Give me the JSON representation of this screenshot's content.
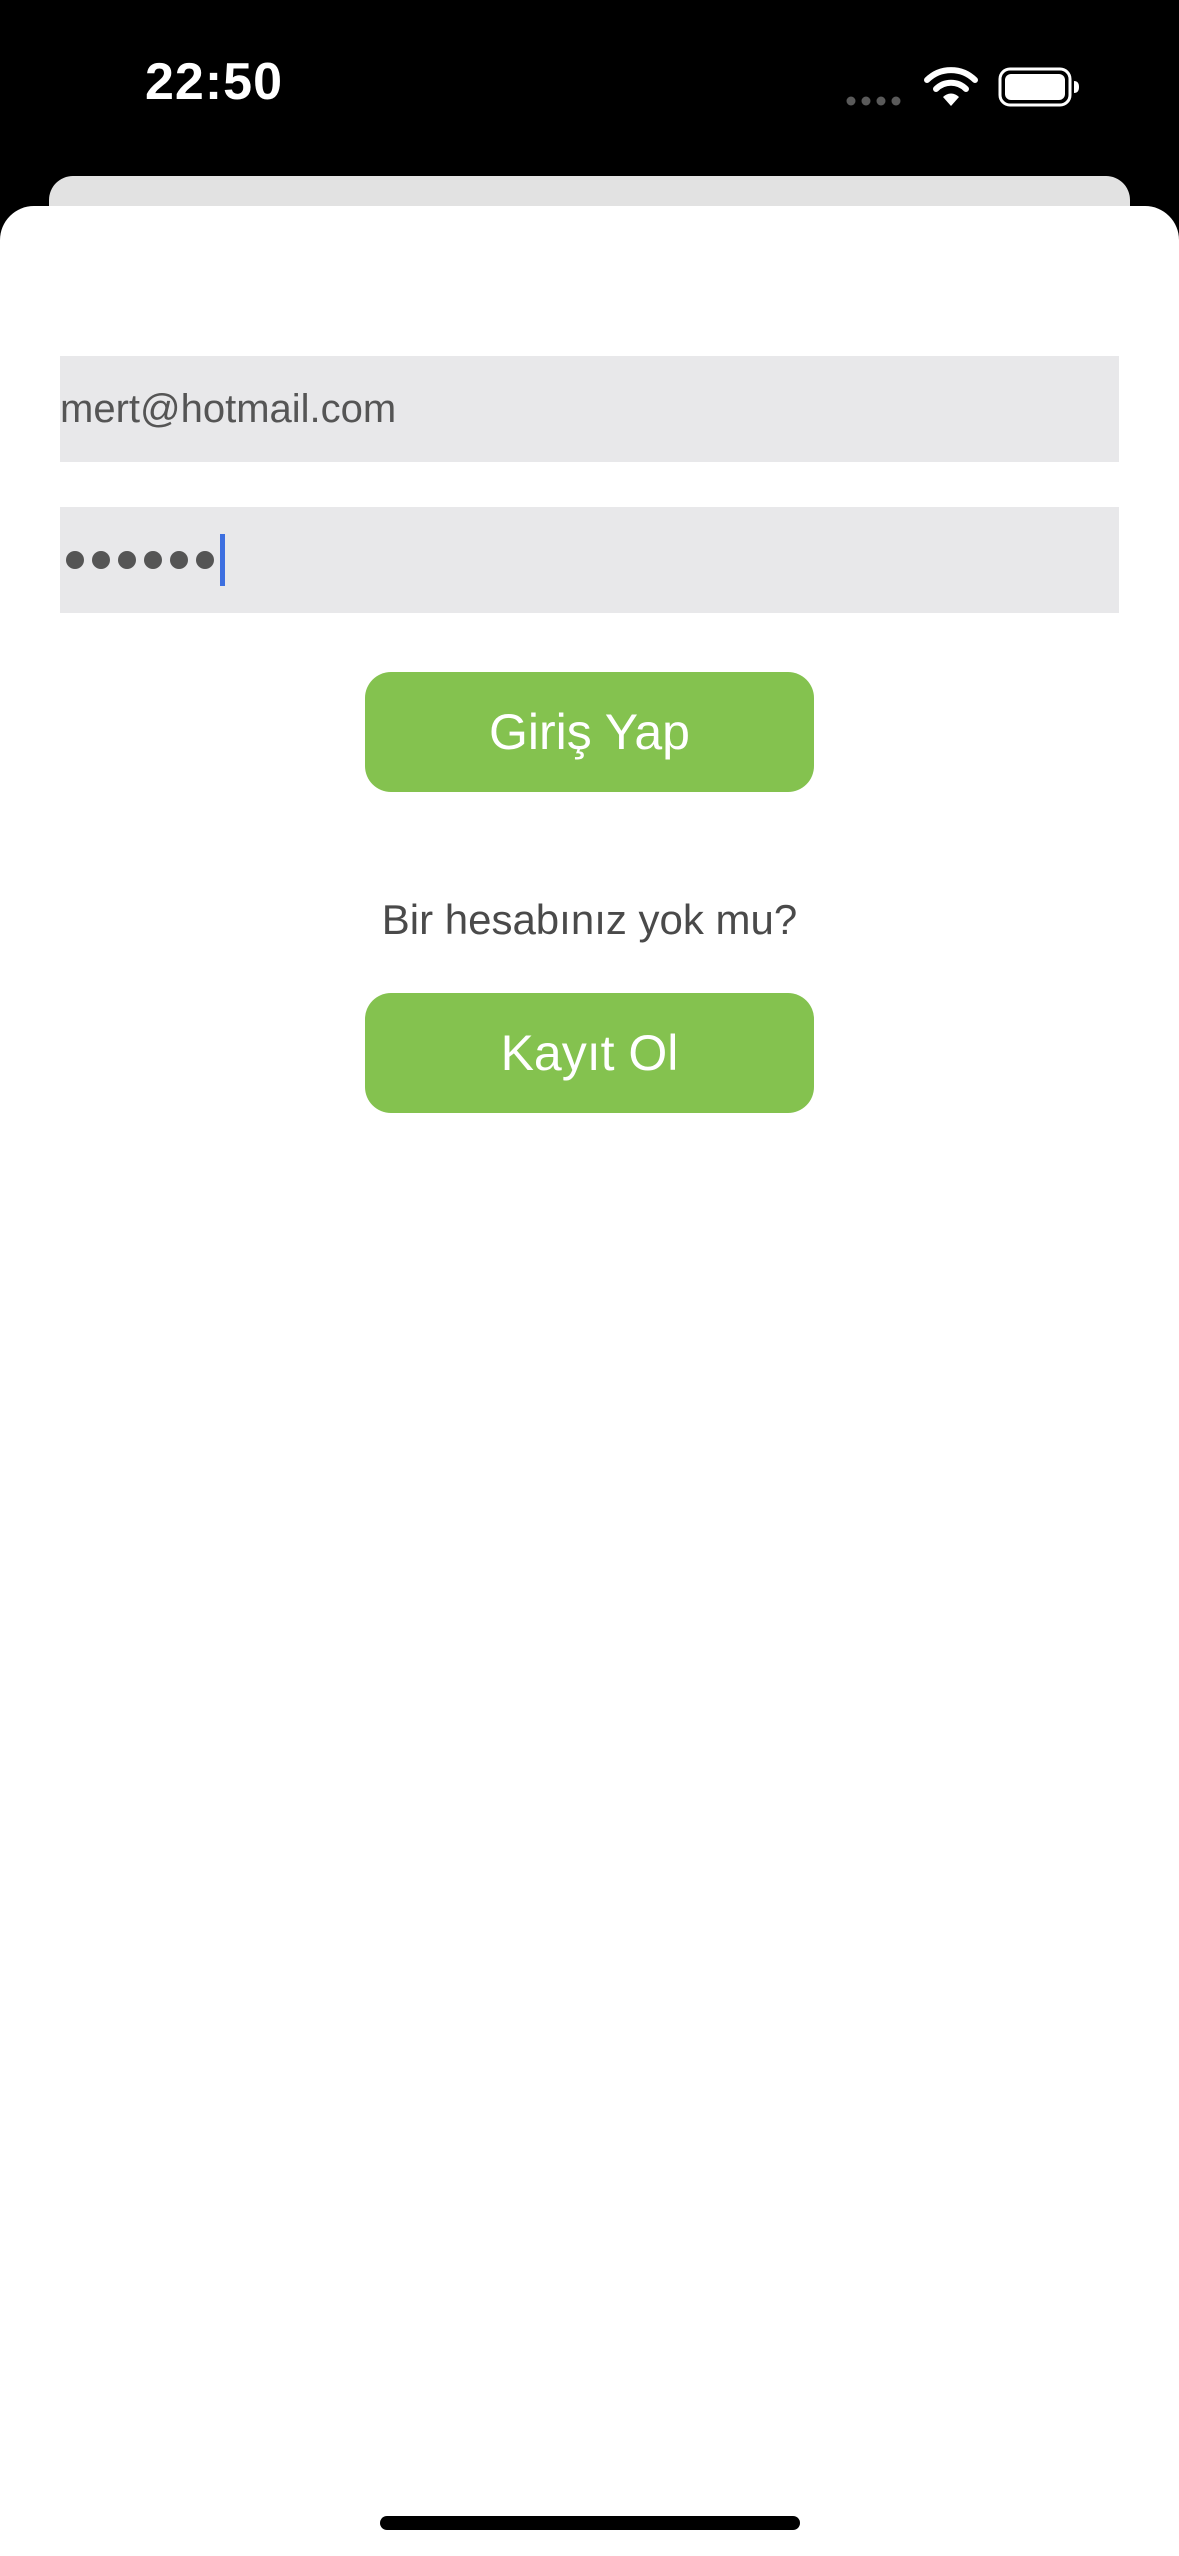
{
  "status_bar": {
    "time": "22:50"
  },
  "login_form": {
    "email_value": "mert@hotmail.com",
    "password_dot_count": 6,
    "login_button_label": "Giriş Yap",
    "no_account_text": "Bir hesabınız yok mu?",
    "signup_button_label": "Kayıt Ol"
  },
  "colors": {
    "button_green": "#84c24f",
    "field_background": "#e8e8ea",
    "caret_blue": "#3d6fe0"
  },
  "icons": [
    "signal-dots-icon",
    "wifi-icon",
    "battery-icon"
  ]
}
